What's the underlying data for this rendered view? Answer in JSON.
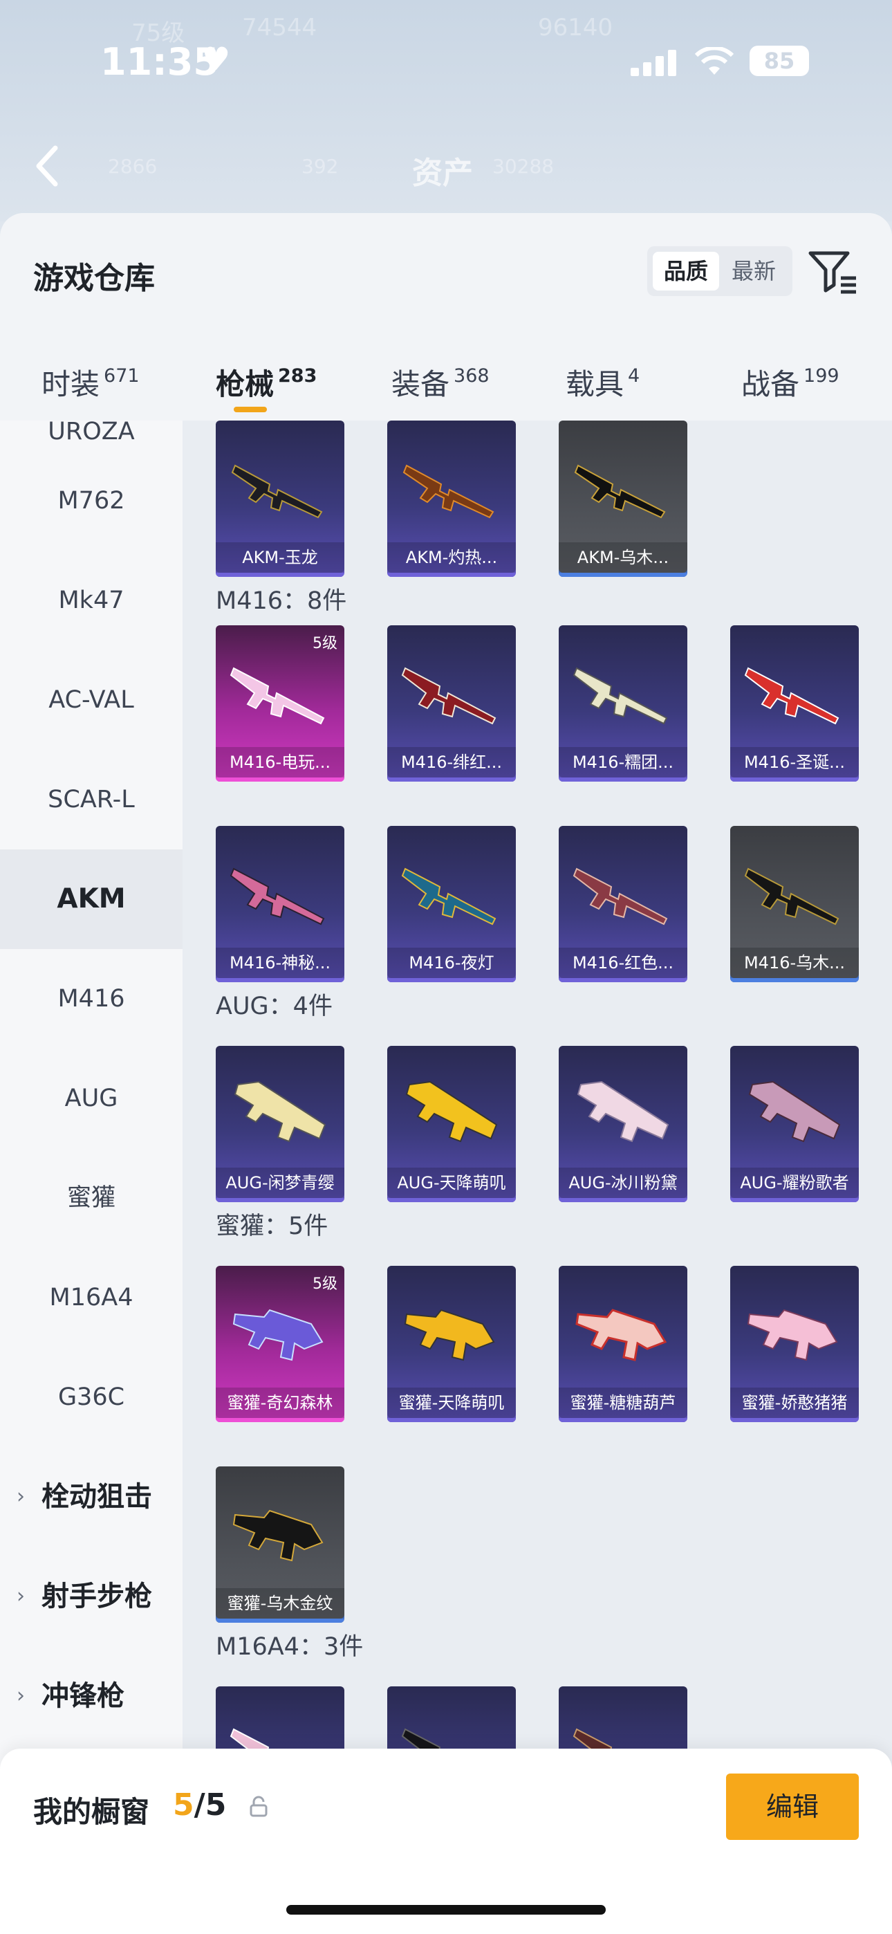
{
  "status_bar": {
    "time": "11:35",
    "battery": "85"
  },
  "background": {
    "title": "资产",
    "ghost_texts": [
      "75级",
      "74544",
      "96140",
      "2866",
      "392",
      "30288"
    ]
  },
  "sheet": {
    "title": "游戏仓库",
    "sort": {
      "active": "品质",
      "other": "最新"
    }
  },
  "tabs": [
    {
      "label": "时装",
      "count": "671"
    },
    {
      "label": "枪械",
      "count": "283",
      "active": true
    },
    {
      "label": "装备",
      "count": "368"
    },
    {
      "label": "载具",
      "count": "4"
    },
    {
      "label": "战备",
      "count": "199"
    }
  ],
  "sidebar": {
    "top_partial": "UROZA",
    "items": [
      "M762",
      "Mk47",
      "AC-VAL",
      "SCAR-L",
      "AKM",
      "M416",
      "AUG",
      "蜜獾",
      "M16A4",
      "G36C"
    ],
    "active": "AKM",
    "groups": [
      "栓动狙击",
      "射手步枪",
      "冲锋枪"
    ]
  },
  "sections": [
    {
      "header": "",
      "cards": [
        {
          "label": "AKM-玉龙",
          "style": "purple"
        },
        {
          "label": "AKM-灼热...",
          "style": "purple"
        },
        {
          "label": "AKM-乌木...",
          "style": "gray"
        }
      ]
    },
    {
      "header": "M416：8件",
      "cards": [
        {
          "label": "M416-电玩...",
          "style": "pink",
          "level": "5级"
        },
        {
          "label": "M416-绯红...",
          "style": "purple"
        },
        {
          "label": "M416-糯团...",
          "style": "purple"
        },
        {
          "label": "M416-圣诞...",
          "style": "purple"
        },
        {
          "label": "M416-神秘...",
          "style": "purple"
        },
        {
          "label": "M416-夜灯",
          "style": "purple"
        },
        {
          "label": "M416-红色...",
          "style": "purple"
        },
        {
          "label": "M416-乌木...",
          "style": "gray"
        }
      ]
    },
    {
      "header": "AUG：4件",
      "cards": [
        {
          "label": "AUG-闲梦青缨",
          "style": "purple"
        },
        {
          "label": "AUG-天降萌叽",
          "style": "purple"
        },
        {
          "label": "AUG-冰川粉黛",
          "style": "purple"
        },
        {
          "label": "AUG-耀粉歌者",
          "style": "purple"
        }
      ]
    },
    {
      "header": "蜜獾：5件",
      "cards": [
        {
          "label": "蜜獾-奇幻森林",
          "style": "pink",
          "level": "5级"
        },
        {
          "label": "蜜獾-天降萌叽",
          "style": "purple"
        },
        {
          "label": "蜜獾-糖糖葫芦",
          "style": "purple"
        },
        {
          "label": "蜜獾-娇憨猪猪",
          "style": "purple"
        },
        {
          "label": "蜜獾-乌木金纹",
          "style": "gray"
        }
      ]
    },
    {
      "header": "M16A4：3件",
      "cards": [
        {
          "label": "",
          "style": "purple"
        },
        {
          "label": "",
          "style": "purple"
        },
        {
          "label": "",
          "style": "purple"
        }
      ]
    }
  ],
  "bottom_bar": {
    "title": "我的橱窗",
    "count_current": "5",
    "count_total": "/5",
    "edit_label": "编辑"
  },
  "colors": {
    "accent": "#f7a81a",
    "card_purple": "#3b3a7c",
    "card_pink": "#c52fb8",
    "card_gray": "#4f5258"
  }
}
